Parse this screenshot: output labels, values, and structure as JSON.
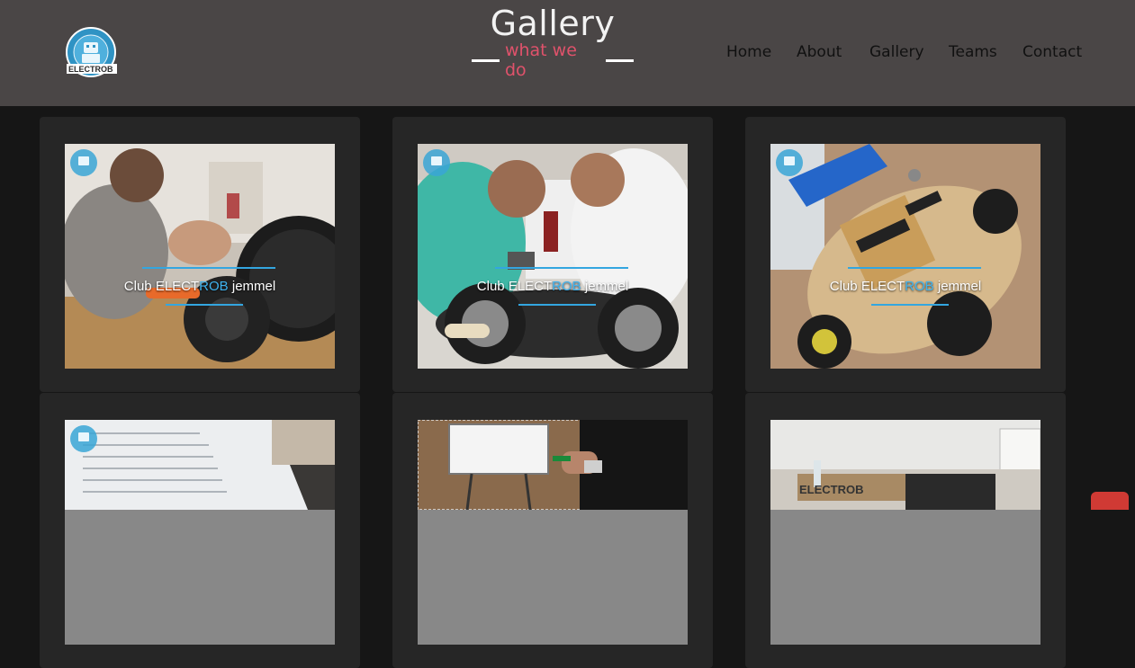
{
  "header": {
    "logo_text": "ELECTROB",
    "title": "Gallery",
    "subtitle": "what we do"
  },
  "nav": {
    "items": [
      {
        "label": "Home"
      },
      {
        "label": "About"
      },
      {
        "label": "Gallery"
      },
      {
        "label": "Teams"
      },
      {
        "label": "Contact"
      }
    ]
  },
  "gallery": {
    "caption_prefix": "Club ELECT",
    "caption_highlight": "ROB",
    "caption_suffix": " jemmel",
    "watermark_text": "ELECT",
    "items": [
      {
        "scene": "workshop-wheels"
      },
      {
        "scene": "team-robot-car"
      },
      {
        "scene": "robot-board"
      },
      {
        "scene": "document-sheet"
      },
      {
        "scene": "whiteboard-presenter"
      },
      {
        "scene": "classroom-boxes"
      }
    ]
  },
  "colors": {
    "header_bg": "#4a4646",
    "page_bg": "#161616",
    "card_bg": "#262626",
    "subtitle": "#e0526b",
    "brand_blue": "#3fb3ef",
    "scroll_button": "#d03a34"
  },
  "icons": {
    "logo": "electrob-logo-icon",
    "scroll_top": "scroll-to-top-icon"
  }
}
